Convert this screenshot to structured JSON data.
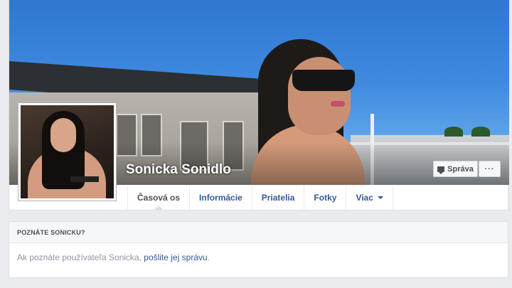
{
  "profile": {
    "name": "Sonicka Sonidlo",
    "message_button": "Správa",
    "more_button": "···"
  },
  "tabs": [
    {
      "label": "Časová os",
      "active": true
    },
    {
      "label": "Informácie"
    },
    {
      "label": "Priatelia"
    },
    {
      "label": "Fotky"
    },
    {
      "label": "Viac"
    }
  ],
  "know_card": {
    "title": "POZNÁTE SONICKU?",
    "text_before": "Ak poznáte používateľa Sonicka, ",
    "link": "pošlite jej správu",
    "text_after": "."
  },
  "colors": {
    "link": "#365899",
    "page_bg": "#e9ebee"
  }
}
